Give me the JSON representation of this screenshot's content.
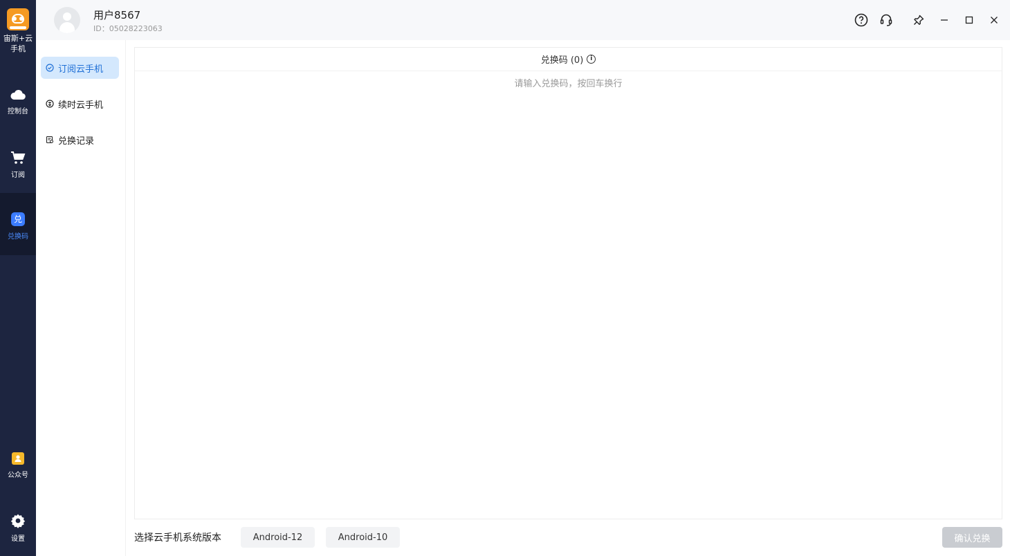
{
  "app": {
    "logo_icon": "robot-logo-icon",
    "name": "宙斯+云手机",
    "accent_color": "#3b7cff",
    "brand_color": "#f59a23"
  },
  "rail": {
    "items": [
      {
        "label": "控制台",
        "icon": "cloud-icon"
      },
      {
        "label": "订阅",
        "icon": "cart-icon"
      },
      {
        "label": "兑换码",
        "icon": "redeem-icon",
        "icon_text": "兑",
        "active": true
      },
      {
        "label": "公众号",
        "icon": "wechat-official-icon"
      },
      {
        "label": "设置",
        "icon": "gear-icon"
      }
    ]
  },
  "header": {
    "username": "用户8567",
    "user_id": "ID：05028223063",
    "icons": [
      "help-icon",
      "headset-icon",
      "pin-icon",
      "minimize-icon",
      "maximize-icon",
      "close-icon"
    ]
  },
  "subnav": {
    "items": [
      {
        "label": "订阅云手机",
        "icon": "check-badge-icon",
        "active": true
      },
      {
        "label": "续时云手机",
        "icon": "renew-icon"
      },
      {
        "label": "兑换记录",
        "icon": "record-icon"
      }
    ]
  },
  "main": {
    "title": "兑换码 (0)",
    "placeholder": "请输入兑换码，按回车换行",
    "value": ""
  },
  "footer": {
    "label": "选择云手机系统版本",
    "versions": [
      "Android-12",
      "Android-10"
    ],
    "confirm_label": "确认兑换"
  }
}
